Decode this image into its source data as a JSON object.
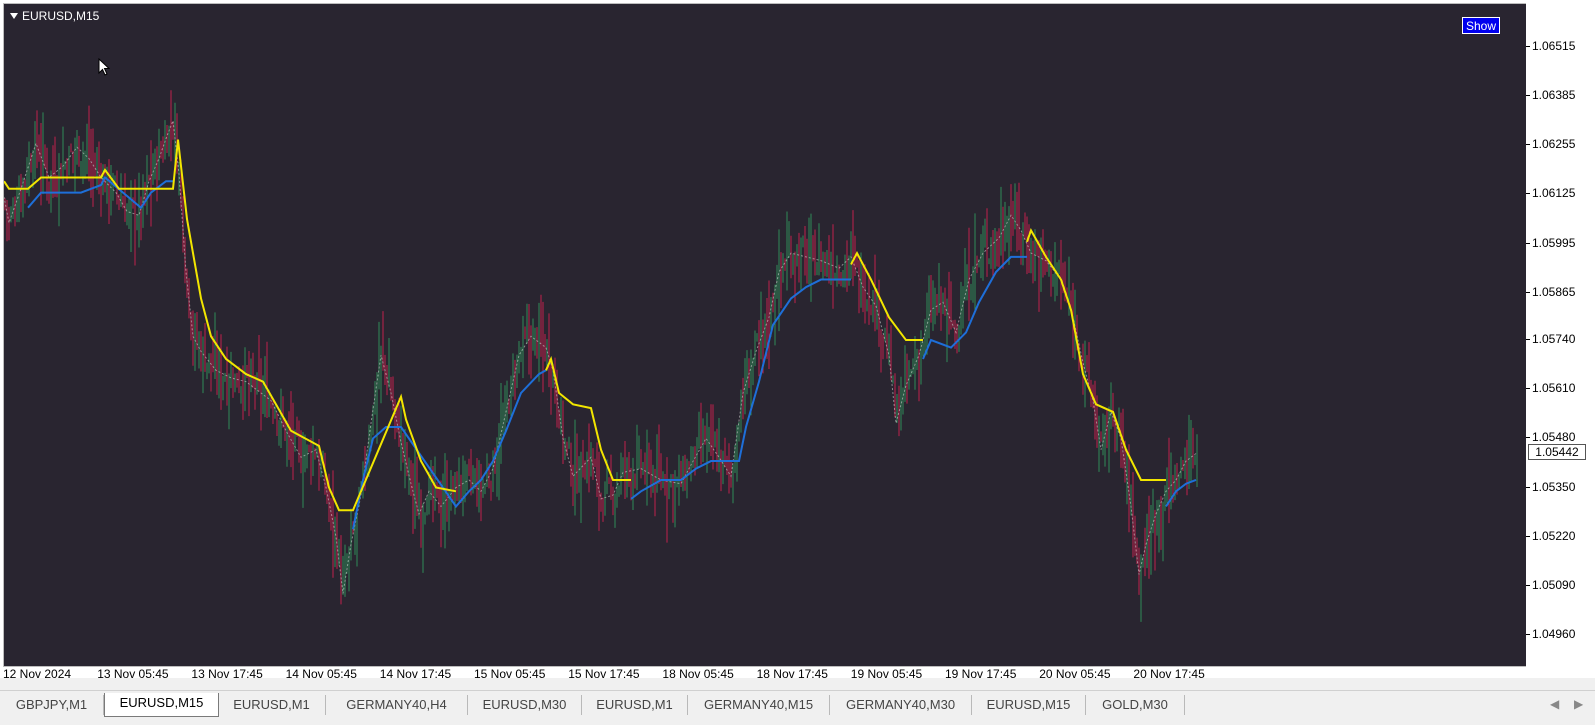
{
  "chart": {
    "title": "EURUSD,M15",
    "show_button": "Show",
    "current_price": "1.05442",
    "price_ticks": [
      "1.06515",
      "1.06385",
      "1.06255",
      "1.06125",
      "1.05995",
      "1.05865",
      "1.05740",
      "1.05610",
      "1.05480",
      "1.05350",
      "1.05220",
      "1.05090",
      "1.04960"
    ],
    "time_ticks": [
      "12 Nov 2024",
      "13 Nov 05:45",
      "13 Nov 17:45",
      "14 Nov 05:45",
      "14 Nov 17:45",
      "15 Nov 05:45",
      "15 Nov 17:45",
      "18 Nov 05:45",
      "18 Nov 17:45",
      "19 Nov 05:45",
      "19 Nov 17:45",
      "20 Nov 05:45",
      "20 Nov 17:45"
    ],
    "colors": {
      "background": "#292530",
      "bull": "#2e8b57",
      "bear": "#c0214b",
      "ma_up": "#1e6fd9",
      "ma_down": "#f2e600",
      "ma_fast": "#cfcfcf"
    }
  },
  "chart_data": {
    "type": "candlestick",
    "title": "EURUSD,M15",
    "ylim": [
      1.049,
      1.0658
    ],
    "price_path": [
      [
        0,
        1.0616
      ],
      [
        8,
        1.0605
      ],
      [
        20,
        1.0614
      ],
      [
        35,
        1.0626
      ],
      [
        48,
        1.0617
      ],
      [
        62,
        1.062
      ],
      [
        76,
        1.0625
      ],
      [
        88,
        1.0622
      ],
      [
        100,
        1.0617
      ],
      [
        115,
        1.0613
      ],
      [
        126,
        1.0608
      ],
      [
        138,
        1.0607
      ],
      [
        148,
        1.0616
      ],
      [
        158,
        1.0622
      ],
      [
        166,
        1.0628
      ],
      [
        172,
        1.0632
      ],
      [
        178,
        1.0618
      ],
      [
        185,
        1.0592
      ],
      [
        192,
        1.0575
      ],
      [
        200,
        1.0571
      ],
      [
        215,
        1.0566
      ],
      [
        230,
        1.0564
      ],
      [
        245,
        1.0563
      ],
      [
        260,
        1.056
      ],
      [
        270,
        1.0558
      ],
      [
        285,
        1.055
      ],
      [
        300,
        1.0543
      ],
      [
        315,
        1.0545
      ],
      [
        325,
        1.0535
      ],
      [
        335,
        1.0522
      ],
      [
        342,
        1.0507
      ],
      [
        350,
        1.052
      ],
      [
        360,
        1.0533
      ],
      [
        370,
        1.0552
      ],
      [
        380,
        1.057
      ],
      [
        390,
        1.056
      ],
      [
        400,
        1.0547
      ],
      [
        410,
        1.0536
      ],
      [
        418,
        1.0528
      ],
      [
        428,
        1.0534
      ],
      [
        440,
        1.053
      ],
      [
        455,
        1.0535
      ],
      [
        468,
        1.0537
      ],
      [
        480,
        1.0534
      ],
      [
        492,
        1.054
      ],
      [
        505,
        1.0555
      ],
      [
        518,
        1.057
      ],
      [
        530,
        1.0575
      ],
      [
        545,
        1.0572
      ],
      [
        552,
        1.0566
      ],
      [
        562,
        1.0548
      ],
      [
        572,
        1.0538
      ],
      [
        590,
        1.0543
      ],
      [
        600,
        1.0532
      ],
      [
        612,
        1.0533
      ],
      [
        622,
        1.0539
      ],
      [
        640,
        1.054
      ],
      [
        660,
        1.0537
      ],
      [
        680,
        1.0536
      ],
      [
        690,
        1.0541
      ],
      [
        705,
        1.0548
      ],
      [
        718,
        1.0543
      ],
      [
        730,
        1.0538
      ],
      [
        742,
        1.056
      ],
      [
        755,
        1.0571
      ],
      [
        768,
        1.058
      ],
      [
        778,
        1.0592
      ],
      [
        790,
        1.0597
      ],
      [
        805,
        1.0596
      ],
      [
        820,
        1.0595
      ],
      [
        838,
        1.0593
      ],
      [
        850,
        1.0596
      ],
      [
        862,
        1.0588
      ],
      [
        875,
        1.0583
      ],
      [
        888,
        1.057
      ],
      [
        895,
        1.0552
      ],
      [
        905,
        1.0562
      ],
      [
        918,
        1.057
      ],
      [
        930,
        1.0582
      ],
      [
        942,
        1.0584
      ],
      [
        955,
        1.0576
      ],
      [
        968,
        1.059
      ],
      [
        982,
        1.0597
      ],
      [
        998,
        1.0601
      ],
      [
        1010,
        1.0607
      ],
      [
        1020,
        1.0603
      ],
      [
        1030,
        1.0597
      ],
      [
        1045,
        1.0595
      ],
      [
        1060,
        1.059
      ],
      [
        1072,
        1.058
      ],
      [
        1082,
        1.0568
      ],
      [
        1092,
        1.0558
      ],
      [
        1100,
        1.0545
      ],
      [
        1110,
        1.0555
      ],
      [
        1120,
        1.0548
      ],
      [
        1130,
        1.053
      ],
      [
        1138,
        1.0512
      ],
      [
        1145,
        1.052
      ],
      [
        1155,
        1.0528
      ],
      [
        1165,
        1.0534
      ],
      [
        1175,
        1.0537
      ],
      [
        1185,
        1.0542
      ],
      [
        1195,
        1.0544
      ]
    ],
    "ma_yellow": [
      [
        3,
        1.0616
      ],
      [
        8,
        1.0614
      ],
      [
        27,
        1.0614
      ],
      [
        40,
        1.0617
      ],
      [
        100,
        1.0617
      ],
      [
        104,
        1.0619
      ],
      [
        118,
        1.0614
      ],
      [
        132,
        1.0614
      ],
      [
        140,
        1.0614
      ],
      [
        172,
        1.0614
      ],
      [
        177,
        1.0627
      ],
      [
        186,
        1.0606
      ],
      [
        200,
        1.0585
      ],
      [
        210,
        1.0575
      ],
      [
        225,
        1.0569
      ],
      [
        245,
        1.0565
      ],
      [
        262,
        1.0563
      ],
      [
        275,
        1.0557
      ],
      [
        290,
        1.055
      ],
      [
        318,
        1.0546
      ],
      [
        328,
        1.0535
      ],
      [
        338,
        1.0529
      ],
      [
        352,
        1.0529
      ],
      [
        400,
        1.0559
      ],
      [
        405,
        1.0553
      ],
      [
        420,
        1.0542
      ],
      [
        435,
        1.0535
      ],
      [
        455,
        1.0534
      ],
      [
        545,
        1.0566
      ],
      [
        550,
        1.0569
      ],
      [
        558,
        1.056
      ],
      [
        572,
        1.0557
      ],
      [
        590,
        1.0556
      ],
      [
        600,
        1.0545
      ],
      [
        612,
        1.0537
      ],
      [
        630,
        1.0537
      ],
      [
        850,
        1.0594
      ],
      [
        856,
        1.0597
      ],
      [
        870,
        1.059
      ],
      [
        888,
        1.058
      ],
      [
        905,
        1.0574
      ],
      [
        922,
        1.0574
      ],
      [
        1026,
        1.06
      ],
      [
        1030,
        1.0603
      ],
      [
        1045,
        1.0596
      ],
      [
        1060,
        1.059
      ],
      [
        1070,
        1.0582
      ],
      [
        1082,
        1.0565
      ],
      [
        1095,
        1.0557
      ],
      [
        1112,
        1.0555
      ],
      [
        1125,
        1.0545
      ],
      [
        1140,
        1.0537
      ],
      [
        1165,
        1.0537
      ]
    ],
    "ma_blue": [
      [
        27,
        1.0609
      ],
      [
        40,
        1.0613
      ],
      [
        60,
        1.0613
      ],
      [
        80,
        1.0613
      ],
      [
        100,
        1.0615
      ],
      [
        104,
        1.0617
      ],
      [
        140,
        1.0609
      ],
      [
        150,
        1.0613
      ],
      [
        165,
        1.0616
      ],
      [
        172,
        1.0616
      ],
      [
        352,
        1.0524
      ],
      [
        362,
        1.0537
      ],
      [
        372,
        1.0548
      ],
      [
        385,
        1.0551
      ],
      [
        400,
        1.0551
      ],
      [
        455,
        1.053
      ],
      [
        468,
        1.0534
      ],
      [
        480,
        1.0537
      ],
      [
        492,
        1.0542
      ],
      [
        505,
        1.055
      ],
      [
        520,
        1.056
      ],
      [
        538,
        1.0565
      ],
      [
        545,
        1.0566
      ],
      [
        630,
        1.0532
      ],
      [
        640,
        1.0534
      ],
      [
        660,
        1.0537
      ],
      [
        680,
        1.0537
      ],
      [
        695,
        1.054
      ],
      [
        710,
        1.0542
      ],
      [
        738,
        1.0542
      ],
      [
        745,
        1.0551
      ],
      [
        758,
        1.0563
      ],
      [
        772,
        1.0578
      ],
      [
        790,
        1.0585
      ],
      [
        805,
        1.0588
      ],
      [
        820,
        1.059
      ],
      [
        850,
        1.059
      ],
      [
        922,
        1.0569
      ],
      [
        930,
        1.0574
      ],
      [
        950,
        1.0572
      ],
      [
        965,
        1.0576
      ],
      [
        978,
        1.0584
      ],
      [
        995,
        1.0592
      ],
      [
        1010,
        1.0596
      ],
      [
        1026,
        1.0596
      ],
      [
        1165,
        1.053
      ],
      [
        1175,
        1.0534
      ],
      [
        1185,
        1.0536
      ],
      [
        1195,
        1.0537
      ]
    ]
  },
  "tabs": [
    {
      "label": "GBPJPY,M1",
      "active": false
    },
    {
      "label": "EURUSD,M15",
      "active": true
    },
    {
      "label": "EURUSD,M1",
      "active": false
    },
    {
      "label": "GERMANY40,H4",
      "active": false
    },
    {
      "label": "EURUSD,M30",
      "active": false
    },
    {
      "label": "EURUSD,M1",
      "active": false
    },
    {
      "label": "GERMANY40,M15",
      "active": false
    },
    {
      "label": "GERMANY40,M30",
      "active": false
    },
    {
      "label": "EURUSD,M15",
      "active": false
    },
    {
      "label": "GOLD,M30",
      "active": false
    }
  ],
  "icons": {
    "collapse": "triangle-down-icon",
    "cursor": "mouse-pointer-icon",
    "scroll_left": "chevron-left-icon",
    "scroll_right": "chevron-right-icon"
  }
}
